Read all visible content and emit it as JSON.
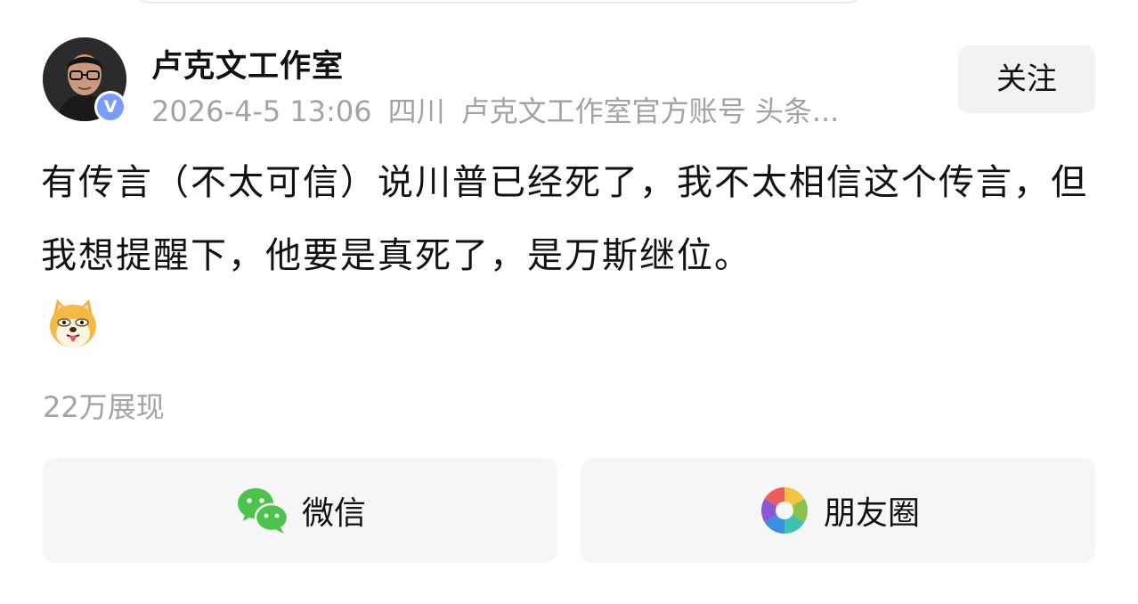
{
  "author": {
    "name": "卢克文工作室",
    "verified_badge": "V",
    "follow_label": "关注"
  },
  "meta": {
    "timestamp": "2026-4-5 13:06",
    "location": "四川",
    "description": "卢克文工作室官方账号 头条..."
  },
  "post": {
    "text": "有传言（不太可信）说川普已经死了，我不太相信这个传言，但我想提醒下，他要是真死了，是万斯继位。",
    "emoji": "dog-tongue-emoji"
  },
  "stats": {
    "views": "22万展现"
  },
  "share": {
    "wechat": {
      "label": "微信",
      "icon": "wechat-icon"
    },
    "moments": {
      "label": "朋友圈",
      "icon": "moments-icon"
    }
  },
  "colors": {
    "meta_gray": "#a3a3a3",
    "verified_blue": "#7b9cff",
    "wechat_green": "#4cc34a",
    "button_bg": "#f6f6f6"
  }
}
